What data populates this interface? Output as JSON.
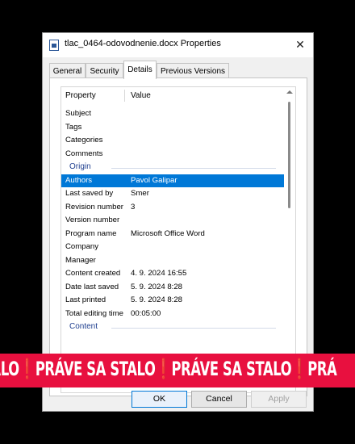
{
  "window": {
    "title": "tlac_0464-odovodnenie.docx Properties",
    "close_icon": "close-icon"
  },
  "tabs": [
    {
      "label": "General"
    },
    {
      "label": "Security"
    },
    {
      "label": "Details",
      "active": true
    },
    {
      "label": "Previous Versions"
    }
  ],
  "details": {
    "columns": {
      "property": "Property",
      "value": "Value"
    },
    "rows": [
      {
        "property": "Subject",
        "value": ""
      },
      {
        "property": "Tags",
        "value": ""
      },
      {
        "property": "Categories",
        "value": ""
      },
      {
        "property": "Comments",
        "value": ""
      },
      {
        "group": "Origin"
      },
      {
        "property": "Authors",
        "value": "Pavol Galipar",
        "selected": true
      },
      {
        "property": "Last saved by",
        "value": "Smer"
      },
      {
        "property": "Revision number",
        "value": "3"
      },
      {
        "property": "Version number",
        "value": ""
      },
      {
        "property": "Program name",
        "value": "Microsoft Office Word"
      },
      {
        "property": "Company",
        "value": ""
      },
      {
        "property": "Manager",
        "value": ""
      },
      {
        "property": "Content created",
        "value": "4. 9. 2024 16:55"
      },
      {
        "property": "Date last saved",
        "value": "5. 9. 2024 8:28"
      },
      {
        "property": "Last printed",
        "value": "5. 9. 2024 8:28"
      },
      {
        "property": "Total editing time",
        "value": "00:05:00"
      },
      {
        "group": "Content"
      }
    ]
  },
  "buttons": {
    "ok": "OK",
    "cancel": "Cancel",
    "apply": "Apply"
  },
  "banner": {
    "segments": [
      "TALO",
      "PRÁVE SA STALO",
      "PRÁVE SA STALO",
      "PRÁ"
    ],
    "separator": "❗"
  },
  "colors": {
    "selection": "#0078d7",
    "banner": "#e8103f",
    "group_header": "#1e3e8f"
  }
}
